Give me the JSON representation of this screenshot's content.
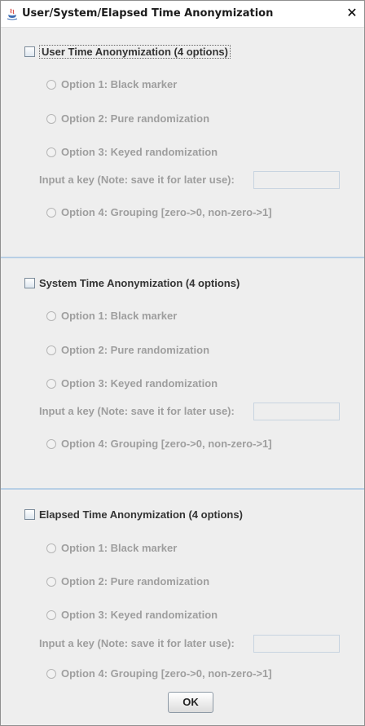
{
  "window": {
    "title": "User/System/Elapsed Time Anonymization",
    "close_label": "✕"
  },
  "sections": [
    {
      "checkbox_label": "User Time Anonymization (4 options)",
      "options": [
        "Option 1: Black marker",
        "Option 2: Pure randomization",
        "Option 3: Keyed randomization"
      ],
      "key_label": "Input a key (Note: save it for later use):",
      "key_value": "",
      "option4": "Option 4: Grouping [zero->0, non-zero->1]"
    },
    {
      "checkbox_label": "System Time Anonymization (4 options)",
      "options": [
        "Option 1: Black marker",
        "Option 2: Pure randomization",
        "Option 3: Keyed randomization"
      ],
      "key_label": "Input a key (Note: save it for later use):",
      "key_value": "",
      "option4": "Option 4: Grouping [zero->0, non-zero->1]"
    },
    {
      "checkbox_label": "Elapsed Time Anonymization (4 options)",
      "options": [
        "Option 1: Black marker",
        "Option 2: Pure randomization",
        "Option 3: Keyed randomization"
      ],
      "key_label": "Input a key (Note: save it for later use):",
      "key_value": "",
      "option4": "Option 4: Grouping [zero->0, non-zero->1]"
    }
  ],
  "ok_label": "OK",
  "colors": {
    "separator": "#b8cfe5",
    "disabled_text": "#9e9e9e",
    "background": "#eeeeee"
  }
}
